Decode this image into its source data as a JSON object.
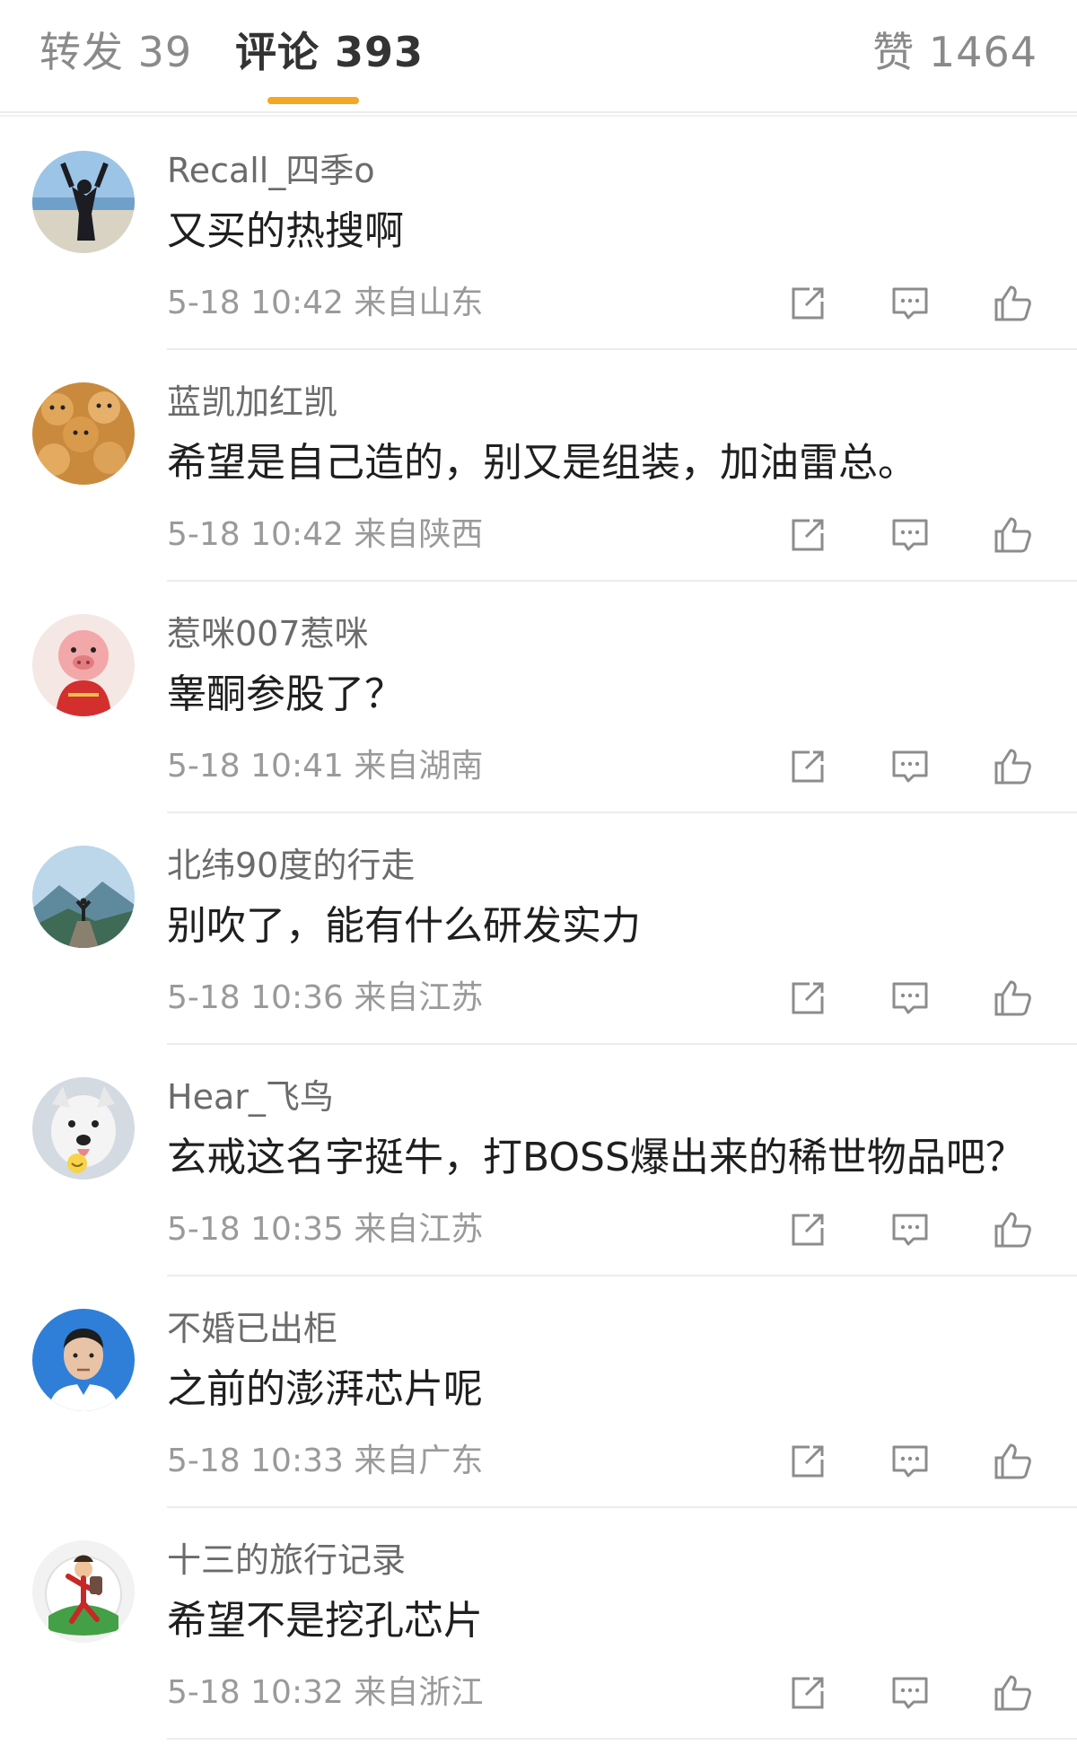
{
  "tabs": {
    "repost": "转发 39",
    "comments": "评论 393",
    "likes": "赞 1464"
  },
  "accent_color": "#f5a623",
  "icons": {
    "share": "share-external-icon",
    "reply": "comment-bubble-icon",
    "like": "thumbs-up-icon"
  },
  "comments": [
    {
      "user": "Recall_四季o",
      "text": "又买的热搜啊",
      "meta": "5-18 10:42 来自山东"
    },
    {
      "user": "蓝凯加红凯",
      "text": "希望是自己造的，别又是组装，加油雷总。",
      "meta": "5-18 10:42 来自陕西"
    },
    {
      "user": "惹咪007惹咪",
      "text": "睾酮参股了？",
      "meta": "5-18 10:41 来自湖南"
    },
    {
      "user": "北纬90度的行走",
      "text": "别吹了，能有什么研发实力",
      "meta": "5-18 10:36 来自江苏"
    },
    {
      "user": "Hear_飞鸟",
      "text": "玄戒这名字挺牛，打BOSS爆出来的稀世物品吧？",
      "meta": "5-18 10:35 来自江苏"
    },
    {
      "user": "不婚已出柜",
      "text": "之前的澎湃芯片呢",
      "meta": "5-18 10:33 来自广东"
    },
    {
      "user": "十三的旅行记录",
      "text": "希望不是挖孔芯片",
      "meta": "5-18 10:32 来自浙江"
    }
  ]
}
